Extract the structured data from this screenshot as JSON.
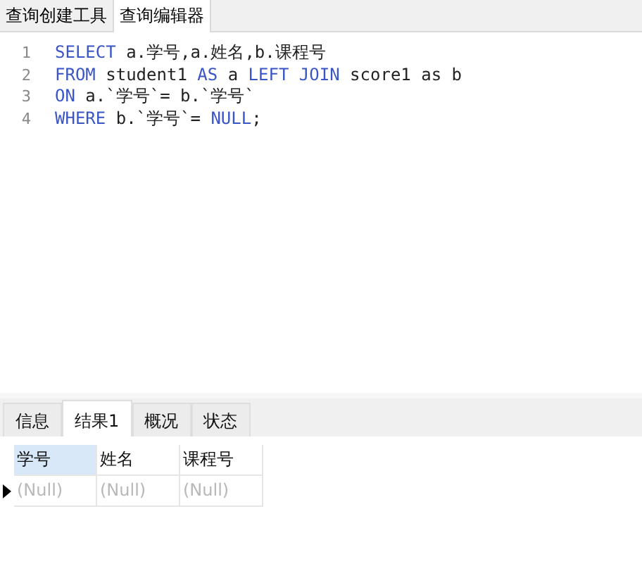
{
  "top_tabs": [
    {
      "label": "查询创建工具",
      "selected": false
    },
    {
      "label": "查询编辑器",
      "selected": true
    }
  ],
  "editor": {
    "lines": [
      {
        "number": "1",
        "tokens": [
          {
            "kind": "keyword",
            "text": "SELECT"
          },
          {
            "kind": "plain",
            "text": " a.学号,a.姓名,b.课程号"
          }
        ]
      },
      {
        "number": "2",
        "tokens": [
          {
            "kind": "keyword",
            "text": "FROM"
          },
          {
            "kind": "plain",
            "text": " student1 "
          },
          {
            "kind": "keyword",
            "text": "AS"
          },
          {
            "kind": "plain",
            "text": " a "
          },
          {
            "kind": "keyword",
            "text": "LEFT JOIN"
          },
          {
            "kind": "plain",
            "text": " score1 as b"
          }
        ]
      },
      {
        "number": "3",
        "tokens": [
          {
            "kind": "keyword",
            "text": "ON"
          },
          {
            "kind": "plain",
            "text": " a.`学号`= b.`学号`"
          }
        ]
      },
      {
        "number": "4",
        "tokens": [
          {
            "kind": "keyword",
            "text": "WHERE"
          },
          {
            "kind": "plain",
            "text": " b.`学号`= "
          },
          {
            "kind": "keyword",
            "text": "NULL"
          },
          {
            "kind": "plain",
            "text": ";"
          }
        ]
      }
    ]
  },
  "result_tabs": [
    {
      "label": "信息",
      "selected": false
    },
    {
      "label": "结果1",
      "selected": true
    },
    {
      "label": "概况",
      "selected": false
    },
    {
      "label": "状态",
      "selected": false
    }
  ],
  "table": {
    "columns": [
      {
        "label": "学号",
        "selected": true
      },
      {
        "label": "姓名",
        "selected": false
      },
      {
        "label": "课程号",
        "selected": false
      }
    ],
    "rows": [
      {
        "current": true,
        "cells": [
          "(Null)",
          "(Null)",
          "(Null)"
        ]
      }
    ]
  }
}
